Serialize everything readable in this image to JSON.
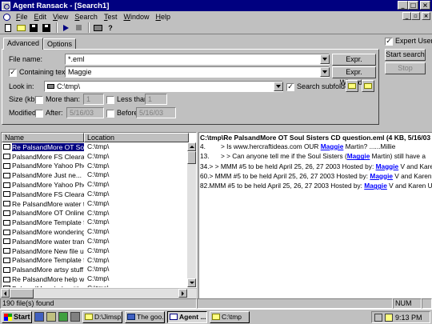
{
  "window": {
    "title": "Agent Ransack - [Search1]"
  },
  "menu": [
    "File",
    "Edit",
    "View",
    "Search",
    "Test",
    "Window",
    "Help"
  ],
  "tabs": [
    "Advanced",
    "Options"
  ],
  "form": {
    "file_name_label": "File name:",
    "file_name_value": "*.eml",
    "containing_text_label": "Containing text:",
    "containing_text_checked": true,
    "containing_text_value": "Maggie",
    "look_in_label": "Look in:",
    "look_in_value": "C:\\tmp\\",
    "search_subfolders_label": "Search subfolders",
    "search_subfolders_checked": true,
    "size_label": "Size (kb):",
    "more_than_label": "More than:",
    "more_than_value": "1",
    "less_than_label": "Less than:",
    "less_than_value": "1",
    "modified_label": "Modified:",
    "after_label": "After:",
    "after_value": "5/16/03",
    "before_label": "Before:",
    "before_value": "5/16/03",
    "expr_wizard_label": "Expr. Wizard...",
    "expert_user_label": "Expert User",
    "expert_user_checked": true,
    "start_search_label": "Start search",
    "stop_label": "Stop"
  },
  "results": {
    "columns": [
      "Name",
      "Location"
    ],
    "rows": [
      {
        "name": "Re PalsandMore OT Sou...",
        "location": "C:\\tmp\\"
      },
      {
        "name": "PalsandMore FS Clearan...",
        "location": "C:\\tmp\\"
      },
      {
        "name": "PalsandMore Yahoo Pho...",
        "location": "C:\\tmp\\"
      },
      {
        "name": "PalsandMore Just ne...",
        "location": "C:\\tmp\\"
      },
      {
        "name": "PalsandMore Yahoo Pho...",
        "location": "C:\\tmp\\"
      },
      {
        "name": "PalsandMore FS Clearan...",
        "location": "C:\\tmp\\"
      },
      {
        "name": "Re PalsandMore water t...",
        "location": "C:\\tmp\\"
      },
      {
        "name": "PalsandMore OT Online ...",
        "location": "C:\\tmp\\"
      },
      {
        "name": "PalsandMore Template f...",
        "location": "C:\\tmp\\"
      },
      {
        "name": "PalsandMore wondering...",
        "location": "C:\\tmp\\"
      },
      {
        "name": "PalsandMore water trans...",
        "location": "C:\\tmp\\"
      },
      {
        "name": "PalsandMore New file up...",
        "location": "C:\\tmp\\"
      },
      {
        "name": "PalsandMore Template f...",
        "location": "C:\\tmp\\"
      },
      {
        "name": "PalsandMore artsy stuff s...",
        "location": "C:\\tmp\\"
      },
      {
        "name": "Re PalsandMore help wit...",
        "location": "C:\\tmp\\"
      },
      {
        "name": "PalsandMore help with e...",
        "location": "C:\\tmp\\"
      }
    ]
  },
  "preview": {
    "header": "C:\\tmp\\Re PalsandMore OT Soul Sisters CD question.eml   (4 KB,  5/16/03 9:11:14",
    "lines": [
      {
        "num": "4.",
        "before": "> Is www.hercraftideas.com OUR ",
        "hit": "Maggie",
        "after": " Martin? ......Millie"
      },
      {
        "num": "13.",
        "before": "> > Can anyone tell me if the Soul Sisters (",
        "hit": "Maggie",
        "after": " Martin) still have a"
      },
      {
        "num": "34.",
        "before": "> > MMM #5 to be held April 25, 26, 27 2003  Hosted by: ",
        "hit": "Maggie",
        "after": " V and Karen U"
      },
      {
        "num": "60.",
        "before": "> MMM #5 to be held April 25, 26, 27 2003  Hosted by: ",
        "hit": "Maggie",
        "after": " V and Karen U"
      },
      {
        "num": "82.",
        "before": "MMM #5 to be held April 25, 26, 27 2003  Hosted by: ",
        "hit": "Maggie",
        "after": " V and Karen U http"
      }
    ]
  },
  "status": {
    "found": "190 file(s) found",
    "num": "NUM"
  },
  "taskbar": {
    "start_label": "Start",
    "tasks": [
      "D:\\Jimsp...",
      "The goo...",
      "Agent ...",
      "C:\\tmp"
    ],
    "active_task_index": 2,
    "clock": "9:13 PM"
  }
}
